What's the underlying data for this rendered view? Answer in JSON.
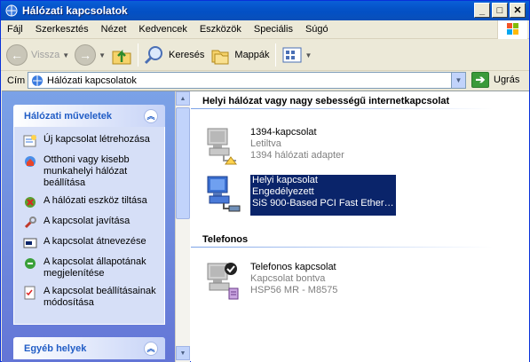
{
  "window": {
    "title": "Hálózati kapcsolatok"
  },
  "window_buttons": {
    "minimize": "_",
    "maximize": "□",
    "close": "✕"
  },
  "menu": [
    "Fájl",
    "Szerkesztés",
    "Nézet",
    "Kedvencek",
    "Eszközök",
    "Speciális",
    "Súgó"
  ],
  "toolbar": {
    "back_label": "Vissza",
    "search_label": "Keresés",
    "folders_label": "Mappák"
  },
  "address": {
    "label": "Cím",
    "value": "Hálózati kapcsolatok",
    "go_label": "Ugrás"
  },
  "tasks": {
    "network_header": "Hálózati műveletek",
    "items": [
      "Új kapcsolat létrehozása",
      "Otthoni vagy kisebb munkahelyi hálózat beállítása",
      "A hálózati eszköz tiltása",
      "A kapcsolat javítása",
      "A kapcsolat átnevezése",
      "A kapcsolat állapotának megjelenítése",
      "A kapcsolat beállításainak módosítása"
    ],
    "other_header": "Egyéb helyek"
  },
  "groups": [
    {
      "title": "Helyi hálózat vagy nagy sebességű internetkapcsolat",
      "connections": [
        {
          "name": "1394-kapcsolat",
          "status": "Letiltva",
          "device": "1394 hálózati adapter",
          "selected": false
        },
        {
          "name": "Helyi kapcsolat",
          "status": "Engedélyezett",
          "device": "SiS 900-Based PCI Fast Ether…",
          "selected": true
        }
      ]
    },
    {
      "title": "Telefonos",
      "connections": [
        {
          "name": "Telefonos kapcsolat",
          "status": "Kapcsolat bontva",
          "device": "HSP56 MR - M8575",
          "selected": false
        }
      ]
    }
  ],
  "colors": {
    "titlebar": "#0453c7",
    "taskpane_gradient_top": "#7ba2e7",
    "taskpane_header_text": "#215dc6",
    "selection": "#0a246a"
  }
}
